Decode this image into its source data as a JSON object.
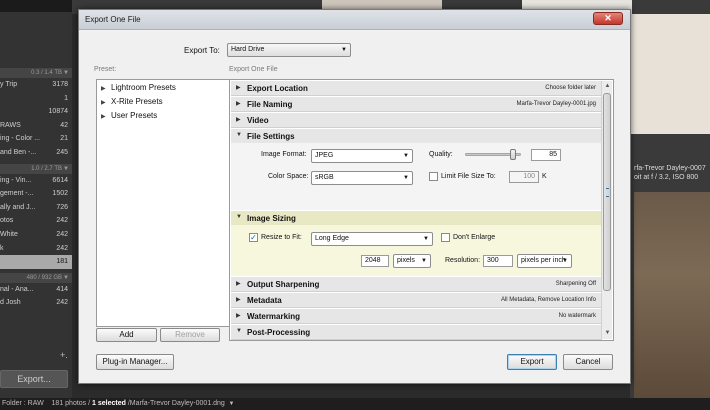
{
  "bg": {
    "panel_header_1": "0.3 / 1.4 TB",
    "panel_header_2": "1.0 / 2.7 TB",
    "panel_header_3": "480 / 932 GB",
    "folders_1": [
      {
        "name": "y Trip",
        "count": "3178"
      },
      {
        "name": "",
        "count": "1"
      },
      {
        "name": "",
        "count": "10874"
      },
      {
        "name": "RAWS",
        "count": "42"
      },
      {
        "name": "ing - Color ...",
        "count": "21"
      },
      {
        "name": "and Ben -...",
        "count": "245"
      }
    ],
    "folders_2": [
      {
        "name": "ing - Vin...",
        "count": "6614"
      },
      {
        "name": "gement -...",
        "count": "1502"
      },
      {
        "name": "ally and J...",
        "count": "726"
      },
      {
        "name": "otos",
        "count": "242"
      },
      {
        "name": "White",
        "count": "242"
      },
      {
        "name": "k",
        "count": "242"
      },
      {
        "name": "",
        "count": "181"
      }
    ],
    "folders_3": [
      {
        "name": "nal - Ana...",
        "count": "414"
      },
      {
        "name": "d Josh",
        "count": "242"
      }
    ],
    "export_button": "Export...",
    "status": {
      "folder": "Folder : RAW",
      "count": "181 photos /",
      "selected": "1 selected",
      "file": "/Marfa-Trevor Dayley-0001.dng"
    },
    "right_caption_1": "rfa-Trevor Dayley-0007",
    "right_caption_2": "oit at f / 3.2, ISO 800"
  },
  "dialog": {
    "title": "Export One File",
    "close_glyph": "✕",
    "export_to_label": "Export To:",
    "export_to_value": "Hard Drive",
    "preset_label": "Preset:",
    "right_heading": "Export One File",
    "presets": [
      "Lightroom Presets",
      "X-Rite Presets",
      "User Presets"
    ],
    "add_button": "Add",
    "remove_button": "Remove",
    "plugin_button": "Plug-in Manager...",
    "export_button": "Export",
    "cancel_button": "Cancel"
  },
  "sections": {
    "export_location": {
      "name": "Export Location",
      "summary": "Choose folder later"
    },
    "file_naming": {
      "name": "File Naming",
      "summary": "Marfa-Trevor Dayley-0001.jpg"
    },
    "video": {
      "name": "Video",
      "summary": ""
    },
    "file_settings": {
      "name": "File Settings"
    },
    "image_sizing": {
      "name": "Image Sizing"
    },
    "output_sharpening": {
      "name": "Output Sharpening",
      "summary": "Sharpening Off"
    },
    "metadata": {
      "name": "Metadata",
      "summary": "All Metadata, Remove Location Info"
    },
    "watermarking": {
      "name": "Watermarking",
      "summary": "No watermark"
    },
    "post_processing": {
      "name": "Post-Processing",
      "summary": ""
    }
  },
  "file_settings": {
    "image_format_label": "Image Format:",
    "image_format_value": "JPEG",
    "quality_label": "Quality:",
    "quality_value": "85",
    "quality_fraction": 0.85,
    "color_space_label": "Color Space:",
    "color_space_value": "sRGB",
    "limit_label": "Limit File Size To:",
    "limit_value": "100",
    "limit_unit": "K"
  },
  "image_sizing": {
    "resize_label": "Resize to Fit:",
    "resize_mode": "Long Edge",
    "dont_enlarge_label": "Don't Enlarge",
    "size_value": "2048",
    "size_unit": "pixels",
    "resolution_label": "Resolution:",
    "resolution_value": "300",
    "resolution_unit": "pixels per inch"
  },
  "glyphs": {
    "expanded": "▼",
    "collapsed": "▶",
    "dropdown": "▼",
    "check": "✓"
  },
  "colors": {
    "image_sizing_band": "#e9e8c4",
    "focus": "#3c7fb1"
  }
}
